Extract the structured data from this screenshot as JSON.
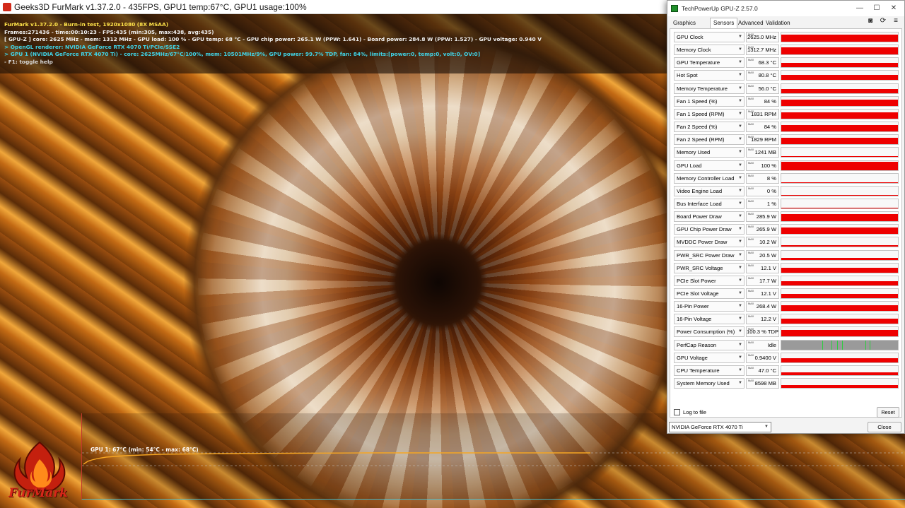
{
  "furmark": {
    "title": "Geeks3D FurMark v1.37.2.0 - 435FPS, GPU1 temp:67°C, GPU1 usage:100%",
    "overlay": [
      {
        "text": "FurMark v1.37.2.0 - Burn-in test, 1920x1080 (8X MSAA)",
        "color": "yellow"
      },
      {
        "text": "Frames:271436 - time:00:10:23 - FPS:435 (min:305, max:438, avg:435)",
        "color": "white"
      },
      {
        "text": "[ GPU-Z ] core: 2625 MHz - mem: 1312 MHz - GPU load: 100 % - GPU temp: 68 °C - GPU chip power: 265.1 W (PPW: 1.641) - Board power: 284.8 W (PPW: 1.527) - GPU voltage: 0.940 V",
        "color": "white"
      },
      {
        "text": "> OpenGL renderer: NVIDIA GeForce RTX 4070 Ti/PCIe/SSE2",
        "color": "cyan"
      },
      {
        "text": "> GPU 1 (NVIDIA GeForce RTX 4070 Ti) - core: 2625MHz/67°C/100%, mem: 10501MHz/9%, GPU power: 99.7% TDP, fan: 84%, limits:[power:0, temp:0, volt:0, OV:0]",
        "color": "cyan"
      },
      {
        "text": "- F1: toggle help",
        "color": "light"
      }
    ],
    "graph_label": "GPU 1: 67°C (min: 54°C - max: 68°C)",
    "logo_text": "FurMark"
  },
  "gpuz": {
    "title": "TechPowerUp GPU-Z 2.57.0",
    "window_buttons": {
      "minimize": "—",
      "maximize": "☐",
      "close": "✕"
    },
    "tabs": [
      "Graphics Card",
      "Sensors",
      "Advanced",
      "Validation"
    ],
    "active_tab": "Sensors",
    "toolbar_icons": [
      "camera-icon",
      "refresh-icon",
      "menu-icon"
    ],
    "toolbar_glyphs": [
      "◙",
      "⟳",
      "≡"
    ],
    "max_tag": "MAX",
    "sensors": [
      {
        "name": "GPU Clock",
        "value": "2625.0 MHz",
        "fill": 0.8
      },
      {
        "name": "Memory Clock",
        "value": "1312.7 MHz",
        "fill": 0.8
      },
      {
        "name": "GPU Temperature",
        "value": "68.3 °C",
        "fill": 0.45
      },
      {
        "name": "Hot Spot",
        "value": "80.8 °C",
        "fill": 0.55
      },
      {
        "name": "Memory Temperature",
        "value": "56.0 °C",
        "fill": 0.45
      },
      {
        "name": "Fan 1 Speed (%)",
        "value": "84 %",
        "fill": 0.7
      },
      {
        "name": "Fan 1 Speed (RPM)",
        "value": "1831 RPM",
        "fill": 0.7
      },
      {
        "name": "Fan 2 Speed (%)",
        "value": "84 %",
        "fill": 0.7
      },
      {
        "name": "Fan 2 Speed (RPM)",
        "value": "1829 RPM",
        "fill": 0.7
      },
      {
        "name": "Memory Used",
        "value": "1241 MB",
        "fill": 0.12
      },
      {
        "name": "GPU Load",
        "value": "100 %",
        "fill": 0.85
      },
      {
        "name": "Memory Controller Load",
        "value": "8 %",
        "fill": 0.0
      },
      {
        "name": "Video Engine Load",
        "value": "0 %",
        "fill": 0.0
      },
      {
        "name": "Bus Interface Load",
        "value": "1 %",
        "fill": 0.0
      },
      {
        "name": "Board Power Draw",
        "value": "285.9 W",
        "fill": 0.75
      },
      {
        "name": "GPU Chip Power Draw",
        "value": "265.9 W",
        "fill": 0.75
      },
      {
        "name": "MVDDC Power Draw",
        "value": "10.2 W",
        "fill": 0.15
      },
      {
        "name": "PWR_SRC Power Draw",
        "value": "20.5 W",
        "fill": 0.22
      },
      {
        "name": "PWR_SRC Voltage",
        "value": "12.1 V",
        "fill": 0.55
      },
      {
        "name": "PCIe Slot Power",
        "value": "17.7 W",
        "fill": 0.45
      },
      {
        "name": "PCIe Slot Voltage",
        "value": "12.1 V",
        "fill": 0.5
      },
      {
        "name": "16-Pin Power",
        "value": "268.4 W",
        "fill": 0.6
      },
      {
        "name": "16-Pin Voltage",
        "value": "12.2 V",
        "fill": 0.55
      },
      {
        "name": "Power Consumption (%)",
        "value": "100.3 % TDP",
        "fill": 0.75
      },
      {
        "name": "PerfCap Reason",
        "value": "Idle",
        "fill": -1
      },
      {
        "name": "GPU Voltage",
        "value": "0.9400 V",
        "fill": 0.45
      },
      {
        "name": "CPU Temperature",
        "value": "47.0 °C",
        "fill": 0.3
      },
      {
        "name": "System Memory Used",
        "value": "8598 MB",
        "fill": 0.3
      }
    ],
    "log_to_file": "Log to file",
    "reset_label": "Reset",
    "gpu_select": "NVIDIA GeForce RTX 4070 Ti",
    "close_label": "Close",
    "colors": {
      "graph_red": "#ee0000",
      "graph_grey": "#9a9a9a",
      "tick_green": "#2ecc40"
    }
  }
}
